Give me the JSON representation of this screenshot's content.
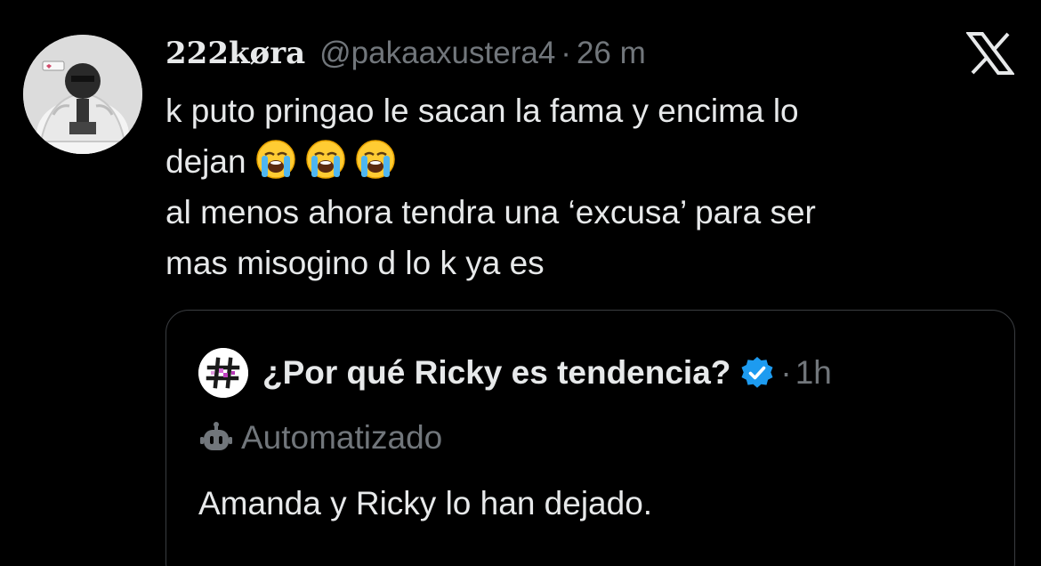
{
  "tweet": {
    "display_name": "222køra",
    "handle": "@pakaaxustera4",
    "separator": "·",
    "time": "26 m",
    "lines": [
      "k puto pringao le sacan la fama y encima lo",
      "dejan",
      "al menos ahora tendra una ‘excusa’ para ser",
      "mas misogino d lo k ya es"
    ],
    "emojis": [
      "loudly-crying-face",
      "loudly-crying-face",
      "loudly-crying-face"
    ]
  },
  "platform_logo": "x-logo",
  "quoted": {
    "name": "¿Por qué Ricky es tendencia?",
    "verified": true,
    "separator": "·",
    "time": "1h",
    "automated_label": "Automatizado",
    "text": "Amanda y Ricky lo han dejado."
  },
  "colors": {
    "background": "#000000",
    "primary_text": "#e7e9ea",
    "secondary_text": "#71767b",
    "verified_blue": "#1d9bf0",
    "border": "#3a3d41"
  }
}
